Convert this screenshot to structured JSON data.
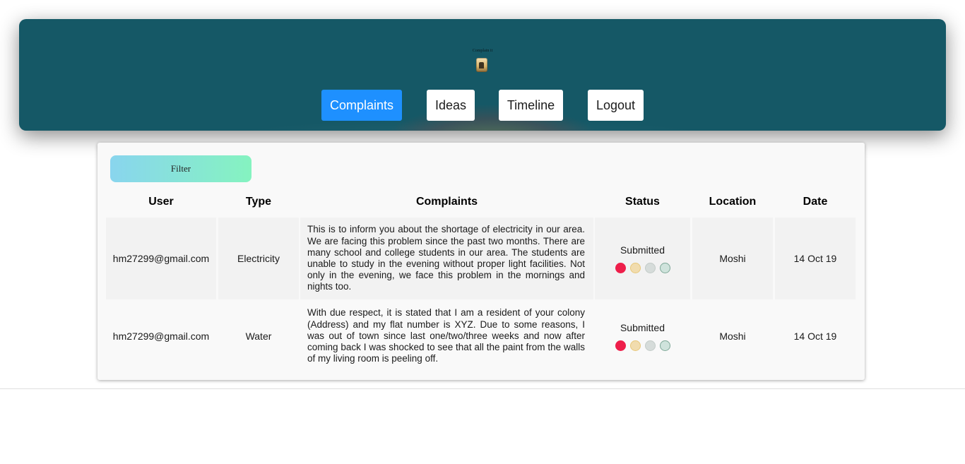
{
  "brand": {
    "title": "Complain it"
  },
  "nav": {
    "items": [
      {
        "label": "Complaints",
        "active": true
      },
      {
        "label": "Ideas",
        "active": false
      },
      {
        "label": "Timeline",
        "active": false
      },
      {
        "label": "Logout",
        "active": false
      }
    ]
  },
  "filter": {
    "label": "Filter"
  },
  "table": {
    "headers": [
      "User",
      "Type",
      "Complaints",
      "Status",
      "Location",
      "Date"
    ],
    "rows": [
      {
        "user": "hm27299@gmail.com",
        "type": "Electricity",
        "complaint": "This is to inform you about the shortage of electricity in our area. We are facing this problem since the past two months. There are many school and college students in our area. The students are unable to study in the evening without proper light facilities. Not only in the evening, we face this problem in the mornings and nights too.",
        "status": "Submitted",
        "location": "Moshi",
        "date": "14 Oct 19"
      },
      {
        "user": "hm27299@gmail.com",
        "type": "Water",
        "complaint": "With due respect, it is stated that I am a resident of your colony (Address) and my flat number is XYZ. Due to some reasons, I was out of town since last one/two/three weeks and now after coming back I was shocked to see that all the paint from the walls of my living room is peeling off.",
        "status": "Submitted",
        "location": "Moshi",
        "date": "14 Oct 19"
      }
    ]
  },
  "status_dots": [
    {
      "name": "submitted-dot",
      "fill": "#ee1e4a",
      "border": "#ee1e4a"
    },
    {
      "name": "in-progress-dot",
      "fill": "#f1dcae",
      "border": "#e8c87a"
    },
    {
      "name": "review-dot",
      "fill": "#d6dcda",
      "border": "#c3cbc8"
    },
    {
      "name": "resolved-dot",
      "fill": "#cfe3dc",
      "border": "#7fa898"
    }
  ]
}
